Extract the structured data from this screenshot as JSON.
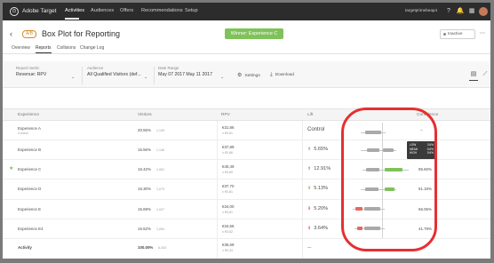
{
  "topbar": {
    "app_title": "Adobe Target",
    "logo_glyph": "⊙",
    "nav": [
      "Activities",
      "Audiences",
      "Offers",
      "Recommendations",
      "Setup"
    ],
    "active_nav": "Activities",
    "user": "targetprimebeap4"
  },
  "header": {
    "back_glyph": "‹",
    "badge": "A/B",
    "title": "Box Plot for Reporting",
    "winner": "Winner: Experience C",
    "status": "Inactive",
    "more": "⋯"
  },
  "tabs": [
    "Overview",
    "Reports",
    "Collisions",
    "Change Log"
  ],
  "active_tab": "Reports",
  "filters": {
    "metric_label": "Report metric",
    "metric_value": "Revenue: RPV",
    "audience_label": "Audience",
    "audience_value": "All Qualified Visitors (def...",
    "date_label": "Date Range",
    "date_value": "May 07 2017 May 11 2017",
    "settings": "Settings",
    "download": "Download"
  },
  "table": {
    "headers": [
      "Experience",
      "Visitors",
      "RPV",
      "Lift",
      "Confidence"
    ],
    "rows": [
      {
        "name": "Experience A",
        "sub": "Control",
        "vis_pct": "20.55%",
        "vis_cnt": "1,149",
        "rpv": "€31,86",
        "rpv_sub": "± €0,81",
        "lift": "Control",
        "lift_dir": "none",
        "conf": "--",
        "winner": false
      },
      {
        "name": "Experience B",
        "sub": "",
        "vis_pct": "15.56%",
        "vis_cnt": "1,146",
        "rpv": "€37,89",
        "rpv_sub": "± €0,86",
        "lift": "5.65%",
        "lift_dir": "up",
        "conf": "",
        "winner": false
      },
      {
        "name": "Experience C",
        "sub": "",
        "vis_pct": "15.42%",
        "vis_cnt": "1,051",
        "rpv": "€40,49",
        "rpv_sub": "± €0,89",
        "lift": "12.91%",
        "lift_dir": "up",
        "conf": "95.60%",
        "winner": true
      },
      {
        "name": "Experience D",
        "sub": "",
        "vis_pct": "16.30%",
        "vis_cnt": "1,075",
        "rpv": "€37,70",
        "rpv_sub": "± €0,81",
        "lift": "5.13%",
        "lift_dir": "up",
        "conf": "51.19%",
        "winner": false
      },
      {
        "name": "Experience E",
        "sub": "",
        "vis_pct": "15.69%",
        "vis_cnt": "1,027",
        "rpv": "€34,00",
        "rpv_sub": "± €0,81",
        "lift": "5.20%",
        "lift_dir": "down",
        "conf": "56.06%",
        "winner": false
      },
      {
        "name": "Experience E4",
        "sub": "",
        "vis_pct": "16.52%",
        "vis_cnt": "1,054",
        "rpv": "€34,56",
        "rpv_sub": "± €0,82",
        "lift": "3.64%",
        "lift_dir": "down",
        "conf": "41.79%",
        "winner": false
      }
    ],
    "total": {
      "name": "Activity",
      "vis_pct": "100.00%",
      "vis_cnt": "6,343",
      "rpv": "€36,69",
      "rpv_sub": "± €0,34",
      "lift": "—",
      "conf": "—"
    }
  },
  "tooltip": {
    "rows": [
      [
        "LOW",
        "3.6%"
      ],
      [
        "MEAN",
        "5.6%"
      ],
      [
        "HIGH",
        "9.6%"
      ]
    ]
  },
  "colors": {
    "winner_green": "#7fc25a",
    "loss_red": "#e8665e",
    "neutral_gray": "#a9a9a9",
    "annotation_red": "#e53030"
  }
}
